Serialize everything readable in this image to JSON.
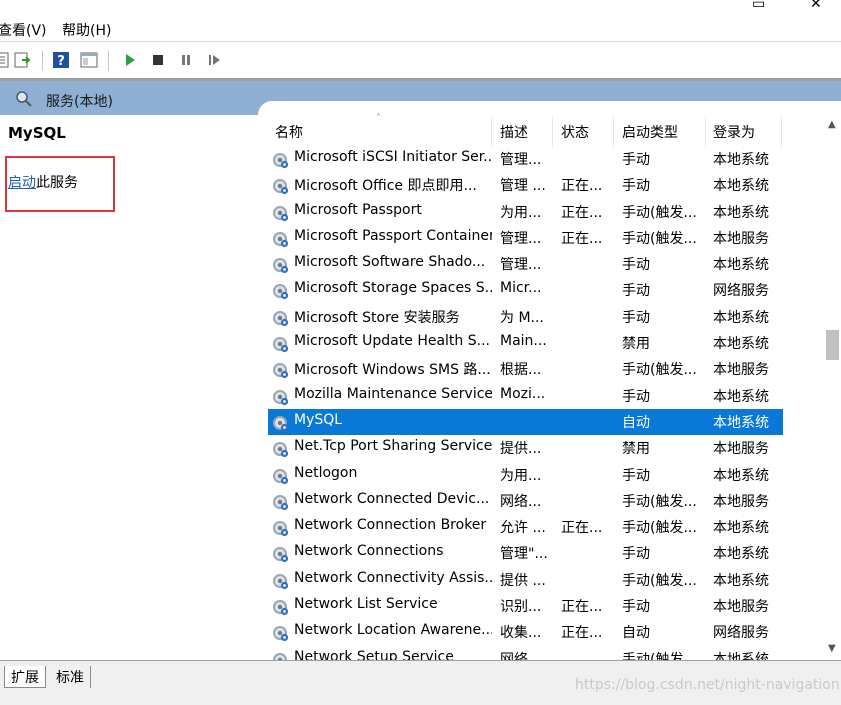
{
  "window": {
    "controls": [
      "▭",
      "✕"
    ]
  },
  "menu": [
    "查看(V)",
    "帮助(H)"
  ],
  "header": {
    "title": "服务(本地)"
  },
  "left": {
    "service_name": "MySQL",
    "action_link": "启动",
    "action_rest": "此服务"
  },
  "columns": {
    "name": "名称",
    "desc": "描述",
    "status": "状态",
    "type": "启动类型",
    "login": "登录为"
  },
  "services": [
    {
      "name": "Microsoft iSCSI Initiator Ser...",
      "desc": "管理...",
      "status": "",
      "type": "手动",
      "login": "本地系统"
    },
    {
      "name": "Microsoft Office 即点即用...",
      "desc": "管理 ...",
      "status": "正在...",
      "type": "手动",
      "login": "本地系统"
    },
    {
      "name": "Microsoft Passport",
      "desc": "为用...",
      "status": "正在...",
      "type": "手动(触发...",
      "login": "本地系统"
    },
    {
      "name": "Microsoft Passport Container",
      "desc": "管理...",
      "status": "正在...",
      "type": "手动(触发...",
      "login": "本地服务"
    },
    {
      "name": "Microsoft Software Shado...",
      "desc": "管理...",
      "status": "",
      "type": "手动",
      "login": "本地系统"
    },
    {
      "name": "Microsoft Storage Spaces S...",
      "desc": "Micr...",
      "status": "",
      "type": "手动",
      "login": "网络服务"
    },
    {
      "name": "Microsoft Store 安装服务",
      "desc": "为 M...",
      "status": "",
      "type": "手动",
      "login": "本地系统"
    },
    {
      "name": "Microsoft Update Health S...",
      "desc": "Main...",
      "status": "",
      "type": "禁用",
      "login": "本地系统"
    },
    {
      "name": "Microsoft Windows SMS 路...",
      "desc": "根据...",
      "status": "",
      "type": "手动(触发...",
      "login": "本地服务"
    },
    {
      "name": "Mozilla Maintenance Service",
      "desc": "Mozi...",
      "status": "",
      "type": "手动",
      "login": "本地系统"
    },
    {
      "name": "MySQL",
      "desc": "",
      "status": "",
      "type": "自动",
      "login": "本地系统",
      "selected": true
    },
    {
      "name": "Net.Tcp Port Sharing Service",
      "desc": "提供...",
      "status": "",
      "type": "禁用",
      "login": "本地服务"
    },
    {
      "name": "Netlogon",
      "desc": "为用...",
      "status": "",
      "type": "手动",
      "login": "本地系统"
    },
    {
      "name": "Network Connected Devic...",
      "desc": "网络...",
      "status": "",
      "type": "手动(触发...",
      "login": "本地服务"
    },
    {
      "name": "Network Connection Broker",
      "desc": "允许 ...",
      "status": "正在...",
      "type": "手动(触发...",
      "login": "本地系统"
    },
    {
      "name": "Network Connections",
      "desc": "管理\"...",
      "status": "",
      "type": "手动",
      "login": "本地系统"
    },
    {
      "name": "Network Connectivity Assis...",
      "desc": "提供 ...",
      "status": "",
      "type": "手动(触发...",
      "login": "本地系统"
    },
    {
      "name": "Network List Service",
      "desc": "识别...",
      "status": "正在...",
      "type": "手动",
      "login": "本地服务"
    },
    {
      "name": "Network Location Awarene...",
      "desc": "收集...",
      "status": "正在...",
      "type": "自动",
      "login": "网络服务"
    },
    {
      "name": "Network Setup Service",
      "desc": "网络...",
      "status": "",
      "type": "手动(触发...",
      "login": "本地系统"
    }
  ],
  "tabs": [
    "扩展",
    "标准"
  ],
  "watermark": "https://blog.csdn.net/night-navigation",
  "colors": {
    "selection": "#0a78d7",
    "header": "#8fb0d2",
    "link": "#1a5fb4",
    "redbox": "#d9363e"
  }
}
